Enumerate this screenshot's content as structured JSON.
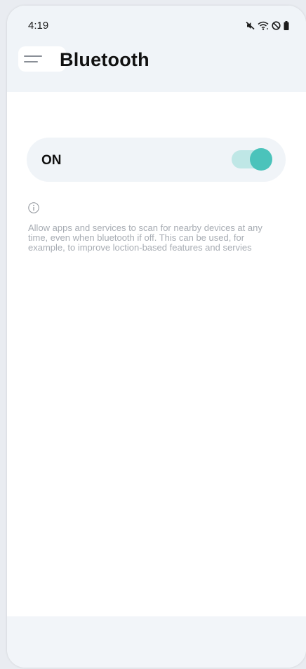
{
  "status_bar": {
    "time": "4:19",
    "icons": [
      "mute-icon",
      "wifi-icon",
      "do-not-disturb-icon",
      "battery-icon"
    ]
  },
  "header": {
    "title": "Bluetooth",
    "menu_icon": "menu-icon"
  },
  "bluetooth": {
    "toggle_label": "ON",
    "enabled": true
  },
  "info": {
    "icon": "info-icon",
    "text": "Allow apps and services to scan for nearby devices at any time, even when bluetooth if off. This can be used, for example, to improve loction-based features and servies"
  },
  "colors": {
    "header_bg": "#f0f4f8",
    "switch_track": "#bfe7e6",
    "switch_knob": "#4bc3bb",
    "info_text": "#a7acb3"
  }
}
